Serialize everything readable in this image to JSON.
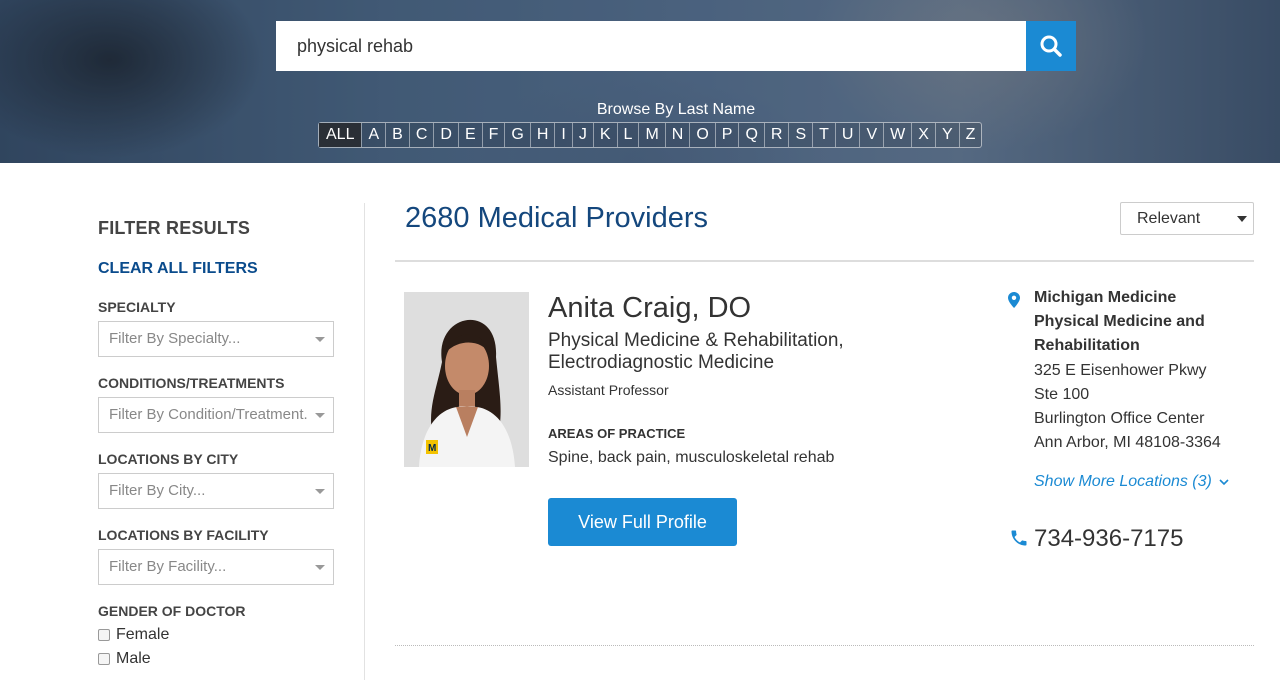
{
  "search": {
    "query": "physical rehab"
  },
  "browse": {
    "label": "Browse By Last Name",
    "letters": [
      "ALL",
      "A",
      "B",
      "C",
      "D",
      "E",
      "F",
      "G",
      "H",
      "I",
      "J",
      "K",
      "L",
      "M",
      "N",
      "O",
      "P",
      "Q",
      "R",
      "S",
      "T",
      "U",
      "V",
      "W",
      "X",
      "Y",
      "Z"
    ]
  },
  "filters": {
    "heading": "FILTER RESULTS",
    "clear_all": "CLEAR ALL FILTERS",
    "specialty": {
      "label": "SPECIALTY",
      "placeholder": "Filter By Specialty..."
    },
    "conditions": {
      "label": "CONDITIONS/TREATMENTS",
      "placeholder": "Filter By Condition/Treatment..."
    },
    "city": {
      "label": "LOCATIONS BY CITY",
      "placeholder": "Filter By City..."
    },
    "facility": {
      "label": "LOCATIONS BY FACILITY",
      "placeholder": "Filter By Facility..."
    },
    "gender": {
      "label": "GENDER OF DOCTOR",
      "options": [
        "Female",
        "Male"
      ]
    }
  },
  "results": {
    "count_text": "2680 Medical Providers",
    "sort_value": "Relevant"
  },
  "provider": {
    "name": "Anita Craig, DO",
    "specialty": "Physical Medicine & Rehabilitation, Electrodiagnostic Medicine",
    "title": "Assistant Professor",
    "areas_label": "AREAS OF PRACTICE",
    "areas": "Spine, back pain, musculoskeletal rehab",
    "profile_button": "View Full Profile",
    "location": {
      "name": "Michigan Medicine Physical Medicine and Rehabilitation",
      "lines": [
        "325 E Eisenhower Pkwy",
        "Ste 100",
        "Burlington Office Center",
        "Ann Arbor, MI 48108-3364"
      ],
      "more": "Show More Locations (3)"
    },
    "phone": "734-936-7175"
  },
  "colors": {
    "accent": "#1b8ad3",
    "heading_blue": "#14477d"
  }
}
